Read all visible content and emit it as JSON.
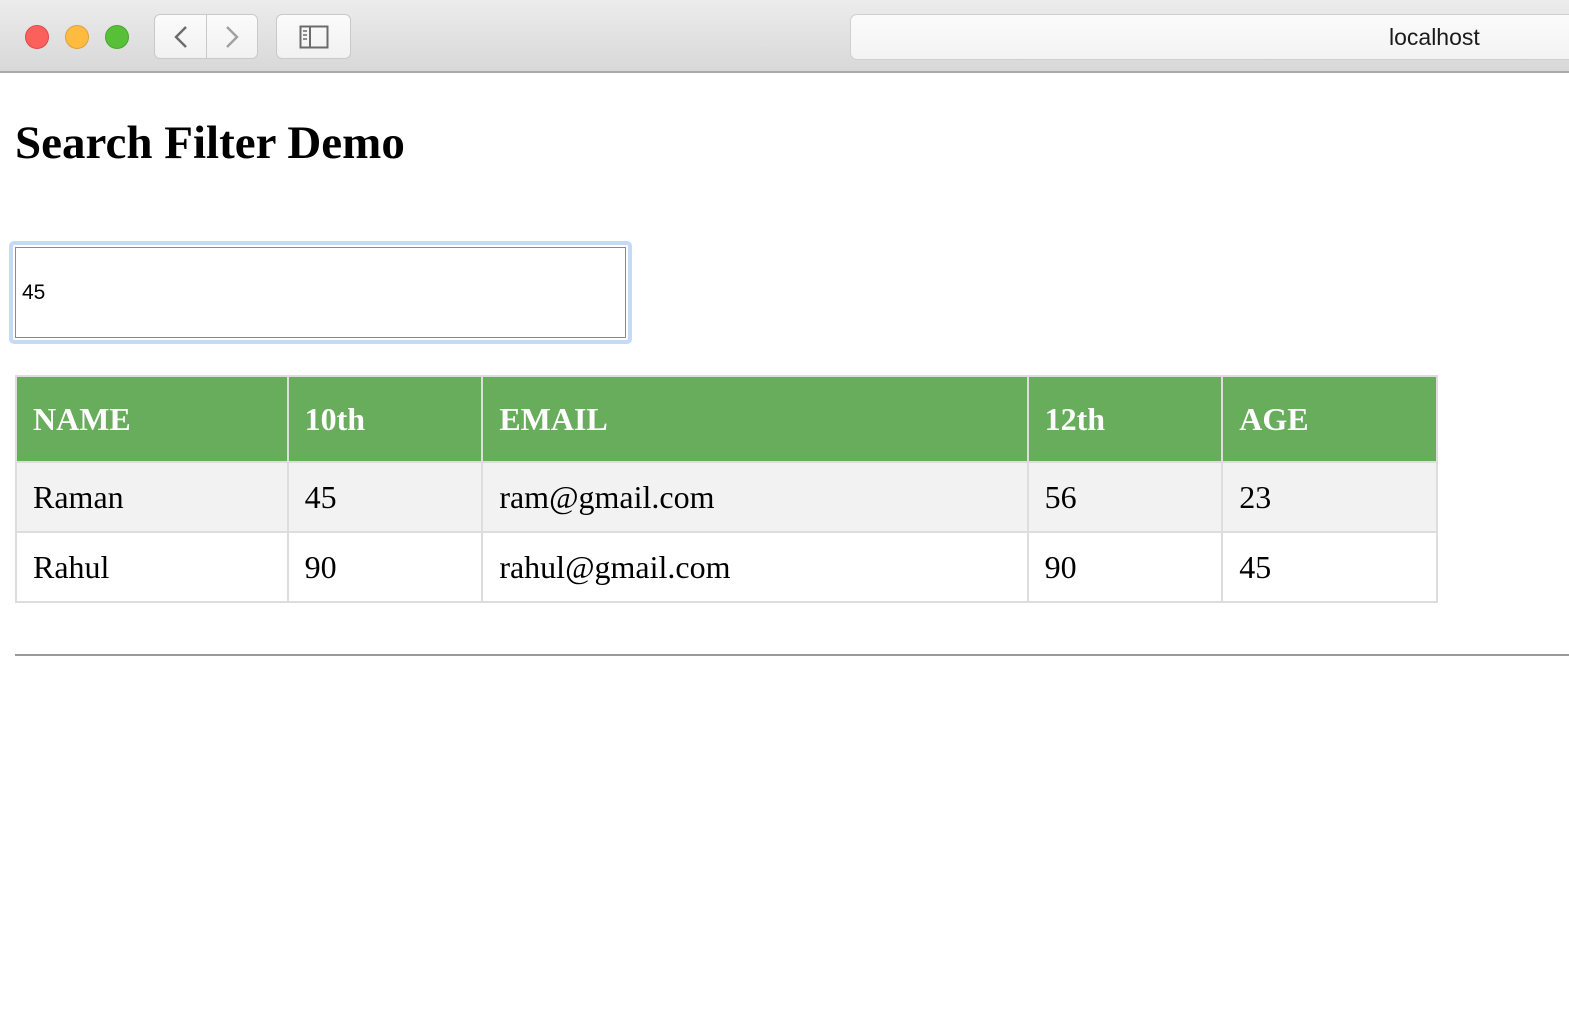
{
  "browser": {
    "url": "localhost"
  },
  "page": {
    "title": "Search Filter Demo",
    "search": {
      "value": "45"
    },
    "table": {
      "headers": [
        "NAME",
        "10th",
        "EMAIL",
        "12th",
        "AGE"
      ],
      "rows": [
        [
          "Raman",
          "45",
          "ram@gmail.com",
          "56",
          "23"
        ],
        [
          "Rahul",
          "90",
          "rahul@gmail.com",
          "90",
          "45"
        ]
      ]
    }
  },
  "colors": {
    "header_bg": "#68ad5c",
    "header_text": "#ffffff",
    "stripe_bg": "#f2f2f2",
    "focus_ring": "#c3dbf6"
  }
}
